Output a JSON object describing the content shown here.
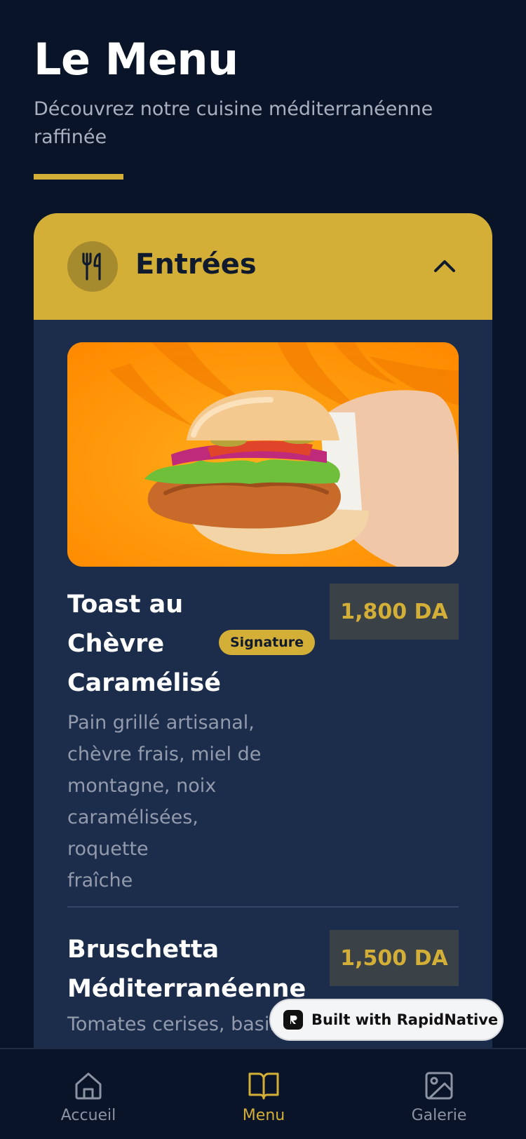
{
  "header": {
    "title": "Le Menu",
    "subtitle": "Découvrez notre cuisine méditerranéenne raffinée"
  },
  "section": {
    "title": "Entrées",
    "icon": "utensils-icon",
    "expanded": true
  },
  "items": [
    {
      "name_lines": [
        "Toast au",
        "Chèvre",
        "Caramélisé"
      ],
      "badge": "Signature",
      "price": "1,800 DA",
      "description_lines": [
        "Pain grillé artisanal,",
        "chèvre frais, miel de",
        "montagne, noix",
        "caramélisées, roquette",
        "fraîche"
      ]
    },
    {
      "name_lines": [
        "Bruschetta",
        "Méditerranéenne"
      ],
      "price": "1,500 DA",
      "description_lines": [
        "Tomates cerises, basilic"
      ]
    }
  ],
  "watermark": {
    "label": "Built with RapidNative"
  },
  "bottom_nav": [
    {
      "label": "Accueil",
      "icon": "home-icon",
      "active": false
    },
    {
      "label": "Menu",
      "icon": "book-icon",
      "active": true
    },
    {
      "label": "Galerie",
      "icon": "image-icon",
      "active": false
    }
  ],
  "colors": {
    "background": "#0a1428",
    "card": "#1c2d4c",
    "accent_gold": "#d4af37",
    "price_box": "#3a4247"
  }
}
